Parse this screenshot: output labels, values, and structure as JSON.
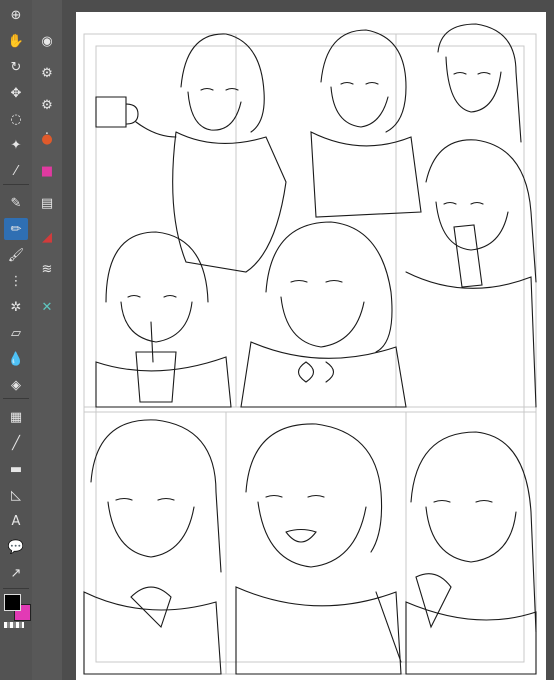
{
  "toolbar": {
    "tools": [
      {
        "name": "zoom-tool-icon",
        "glyph": "⊕",
        "active": false
      },
      {
        "name": "hand-tool-icon",
        "glyph": "✋",
        "active": false
      },
      {
        "name": "rotate-tool-icon",
        "glyph": "↻",
        "active": false
      },
      {
        "name": "move-tool-icon",
        "glyph": "✥",
        "active": false
      },
      {
        "name": "lasso-tool-icon",
        "glyph": "◌",
        "active": false
      },
      {
        "name": "magic-wand-tool-icon",
        "glyph": "✦",
        "active": false
      },
      {
        "name": "eyedropper-tool-icon",
        "glyph": "⁄",
        "active": false
      },
      {
        "name": "pen-tool-icon",
        "glyph": "✎",
        "active": false
      },
      {
        "name": "pencil-tool-icon",
        "glyph": "✏",
        "active": true
      },
      {
        "name": "brush-tool-icon",
        "glyph": "🖌",
        "active": false
      },
      {
        "name": "airbrush-tool-icon",
        "glyph": "⋮",
        "active": false
      },
      {
        "name": "decoration-tool-icon",
        "glyph": "✲",
        "active": false
      },
      {
        "name": "eraser-tool-icon",
        "glyph": "▱",
        "active": false
      },
      {
        "name": "blend-tool-icon",
        "glyph": "💧",
        "active": false
      },
      {
        "name": "fill-tool-icon",
        "glyph": "◈",
        "active": false
      },
      {
        "name": "gradient-tool-icon",
        "glyph": "▦",
        "active": false
      },
      {
        "name": "line-tool-icon",
        "glyph": "╱",
        "active": false
      },
      {
        "name": "frame-tool-icon",
        "glyph": "▬",
        "active": false
      },
      {
        "name": "ruler-tool-icon",
        "glyph": "◺",
        "active": false
      },
      {
        "name": "text-tool-icon",
        "glyph": "A",
        "active": false
      },
      {
        "name": "balloon-tool-icon",
        "glyph": "💬",
        "active": false
      },
      {
        "name": "correct-line-tool-icon",
        "glyph": "↗",
        "active": false
      }
    ]
  },
  "subtools": [
    {
      "name": "navigator-icon",
      "glyph": "◉"
    },
    {
      "name": "sub-tool-icon",
      "glyph": "⚙"
    },
    {
      "name": "tool-property-icon",
      "glyph": "⚙"
    },
    {
      "name": "brush-size-icon",
      "glyph": "⁝"
    },
    {
      "name": "color-wheel-icon",
      "glyph": "●"
    },
    {
      "name": "color-set-icon",
      "glyph": "■"
    },
    {
      "name": "layer-icon",
      "glyph": "▤"
    },
    {
      "name": "layer-property-icon",
      "glyph": "◢"
    },
    {
      "name": "layer-search-icon",
      "glyph": "≋"
    },
    {
      "name": "material-icon",
      "glyph": "✕"
    }
  ],
  "colors": {
    "main": "#000000",
    "sub": "#e23ab5",
    "active_tool_bg": "#2f6fb3",
    "canvas_bg": "#ffffff"
  }
}
